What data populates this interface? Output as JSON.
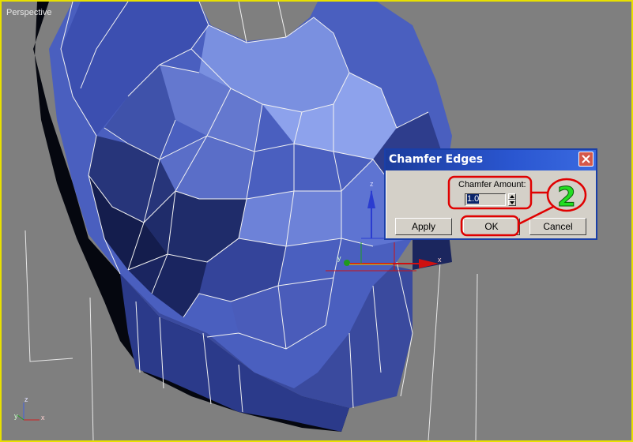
{
  "viewport": {
    "label": "Perspective",
    "border_color": "#e8e000",
    "background_color": "#7f7f7f",
    "mesh_color": "#4a5fbf",
    "axis_labels": {
      "z": "z",
      "x": "x",
      "y": "y"
    }
  },
  "dialog": {
    "title": "Chamfer Edges",
    "amount_label": "Chamfer Amount:",
    "amount_value": "1.0",
    "apply_label": "Apply",
    "ok_label": "OK",
    "cancel_label": "Cancel",
    "close_icon": "close-x-icon"
  },
  "annotation": {
    "step_number": "2",
    "highlight_color": "#e00000",
    "number_color": "#22dd22"
  }
}
